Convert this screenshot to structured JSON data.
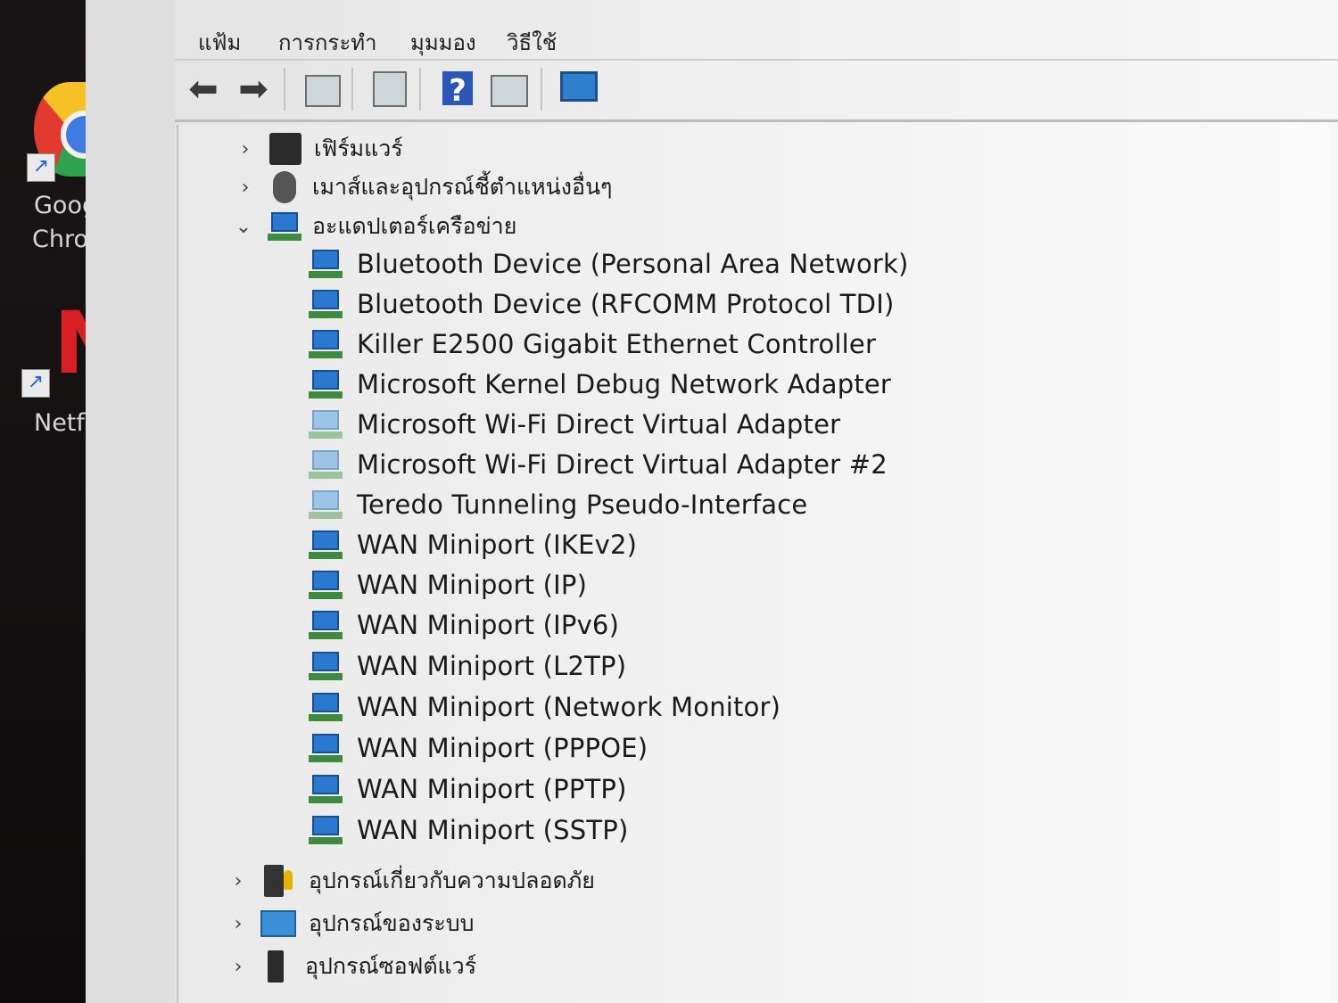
{
  "desktop": {
    "icons": [
      {
        "label_line1": "Goog",
        "label_line2": "Chron"
      },
      {
        "label_line1": "Netfl"
      }
    ]
  },
  "menu": [
    "แฟ้ม",
    "การกระทำ",
    "มุมมอง",
    "วิธีใช้"
  ],
  "toolbar": {
    "icons": [
      "back-arrow-icon",
      "forward-arrow-icon",
      "show-hide-console-tree-icon",
      "properties-icon",
      "help-icon",
      "action-pane-icon",
      "scan-hardware-monitor-icon"
    ]
  },
  "tree": {
    "categories_above": [
      {
        "label": "เฟิร์มแวร์",
        "icon": "firmware-icon",
        "expanded": false
      },
      {
        "label": "เมาส์และอุปกรณ์ชี้ตำแหน่งอื่นๆ",
        "icon": "mouse-icon",
        "expanded": false
      }
    ],
    "network_category": {
      "label": "อะแดปเตอร์เครือข่าย",
      "icon": "network-adapter-icon",
      "expanded": true
    },
    "devices": [
      {
        "label": "Bluetooth Device (Personal Area Network)",
        "faded": false
      },
      {
        "label": "Bluetooth Device (RFCOMM Protocol TDI)",
        "faded": false
      },
      {
        "label": "Killer E2500 Gigabit Ethernet Controller",
        "faded": false
      },
      {
        "label": "Microsoft Kernel Debug Network Adapter",
        "faded": false
      },
      {
        "label": "Microsoft Wi-Fi Direct Virtual Adapter",
        "faded": true
      },
      {
        "label": "Microsoft Wi-Fi Direct Virtual Adapter #2",
        "faded": true
      },
      {
        "label": "Teredo Tunneling Pseudo-Interface",
        "faded": true
      },
      {
        "label": "WAN Miniport (IKEv2)",
        "faded": false
      },
      {
        "label": "WAN Miniport (IP)",
        "faded": false
      },
      {
        "label": "WAN Miniport (IPv6)",
        "faded": false
      },
      {
        "label": "WAN Miniport (L2TP)",
        "faded": false
      },
      {
        "label": "WAN Miniport (Network Monitor)",
        "faded": false
      },
      {
        "label": "WAN Miniport (PPPOE)",
        "faded": false
      },
      {
        "label": "WAN Miniport (PPTP)",
        "faded": false
      },
      {
        "label": "WAN Miniport (SSTP)",
        "faded": false
      }
    ],
    "categories_below": [
      {
        "label": "อุปกรณ์เกี่ยวกับความปลอดภัย",
        "icon": "security-device-icon",
        "expanded": false
      },
      {
        "label": "อุปกรณ์ของระบบ",
        "icon": "system-device-icon",
        "expanded": false
      },
      {
        "label": "อุปกรณ์ซอฟต์แวร์",
        "icon": "software-device-icon",
        "expanded": false
      }
    ]
  }
}
